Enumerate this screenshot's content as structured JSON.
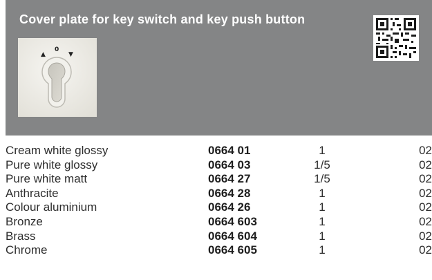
{
  "header": {
    "title": "Cover plate for key switch and key push button",
    "bg_color": "#848586"
  },
  "product_image": {
    "symbols": {
      "left": "▲",
      "center": "0",
      "right": "▼"
    }
  },
  "qr_code": {
    "icon": "qr-code-icon"
  },
  "columns": [
    "name",
    "article_no",
    "packaging",
    "price_group"
  ],
  "rows": [
    {
      "name": "Cream white glossy",
      "code": "0664 01",
      "pack": "1",
      "pg": "02"
    },
    {
      "name": "Pure white glossy",
      "code": "0664 03",
      "pack": "1/5",
      "pg": "02"
    },
    {
      "name": "Pure white matt",
      "code": "0664 27",
      "pack": "1/5",
      "pg": "02"
    },
    {
      "name": "Anthracite",
      "code": "0664 28",
      "pack": "1",
      "pg": "02"
    },
    {
      "name": "Colour aluminium",
      "code": "0664 26",
      "pack": "1",
      "pg": "02"
    },
    {
      "name": "Bronze",
      "code": "0664 603",
      "pack": "1",
      "pg": "02"
    },
    {
      "name": "Brass",
      "code": "0664 604",
      "pack": "1",
      "pg": "02"
    },
    {
      "name": "Chrome",
      "code": "0664 605",
      "pack": "1",
      "pg": "02"
    }
  ]
}
